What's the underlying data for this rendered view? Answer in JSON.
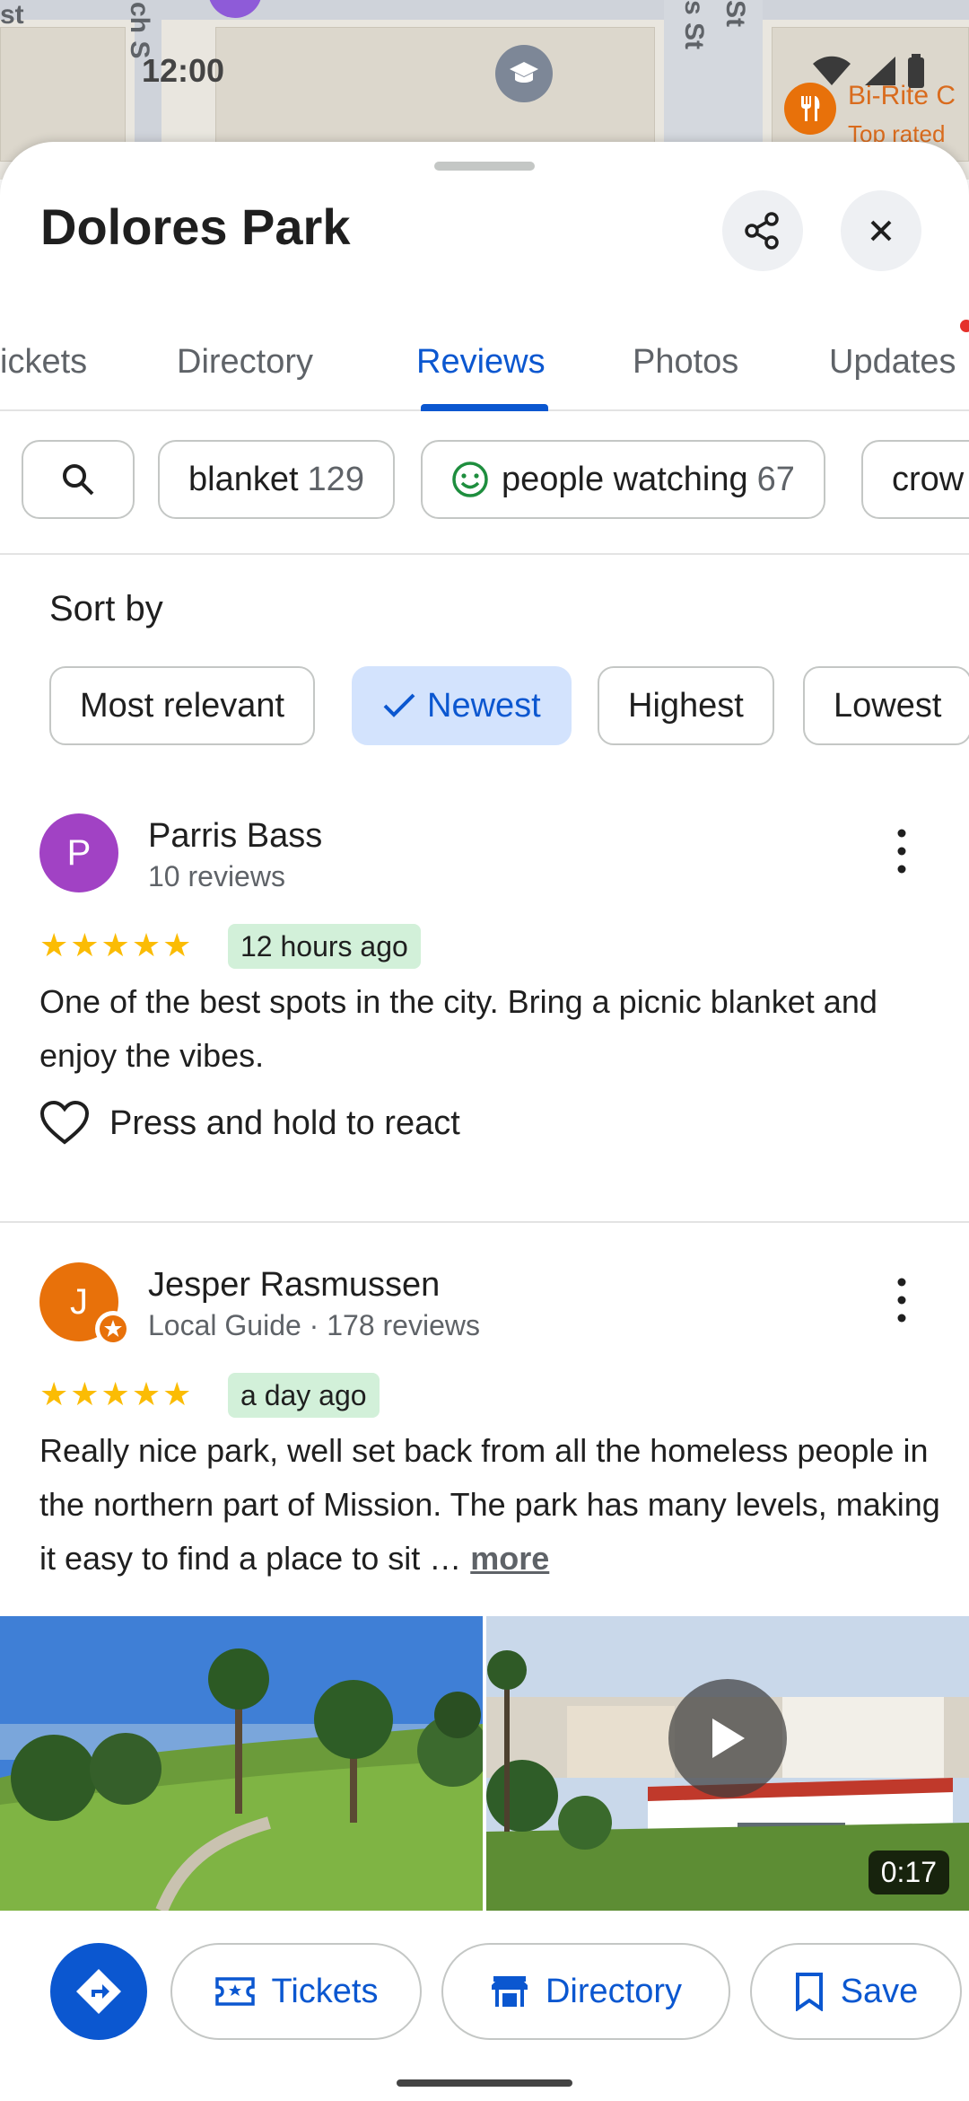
{
  "map": {
    "street_labels": [
      "st",
      "ch S",
      "s St",
      "St"
    ],
    "time_label": "12:00",
    "place_name": "Bi-Rite C",
    "place_sub": "Top rated"
  },
  "header": {
    "title": "Dolores Park",
    "share_icon": "share-icon",
    "close_icon": "close-icon"
  },
  "tabs": [
    {
      "label": "ickets"
    },
    {
      "label": "Directory"
    },
    {
      "label": "Reviews",
      "active": true
    },
    {
      "label": "Photos"
    },
    {
      "label": "Updates"
    }
  ],
  "topics": [
    {
      "label": "blanket",
      "count": "129"
    },
    {
      "label": "people watching",
      "count": "67"
    },
    {
      "label": "crow",
      "count": ""
    }
  ],
  "sort": {
    "title": "Sort by",
    "options": [
      "Most relevant",
      "Newest",
      "Highest",
      "Lowest"
    ],
    "selected": "Newest"
  },
  "reviews": [
    {
      "initial": "P",
      "avatar_color": "#a142c4",
      "name": "Parris Bass",
      "subtitle": "10 reviews",
      "rating": 5,
      "stars": "★★★★★",
      "time": "12 hours ago",
      "text": "One of the best spots in the city. Bring a picnic blanket and enjoy the vibes.",
      "react_label": "Press and hold to react"
    },
    {
      "initial": "J",
      "avatar_color": "#e8710a",
      "name": "Jesper Rasmussen",
      "subtitle": "Local Guide · 178 reviews",
      "rating": 5,
      "stars": "★★★★★",
      "time": "a day ago",
      "text": "Really nice park, well set back from all the homeless people in the northern part of Mission.  The park has many levels, making it easy to find a place to sit …",
      "more_label": "more",
      "video_duration": "0:17"
    }
  ],
  "actions": {
    "tickets": "Tickets",
    "directory": "Directory",
    "save": "Save"
  },
  "colors": {
    "accent": "#0b57d0",
    "star": "#fbbc04",
    "badge_bg": "#d2f0d9",
    "selected_chip": "#d3e3fd"
  }
}
